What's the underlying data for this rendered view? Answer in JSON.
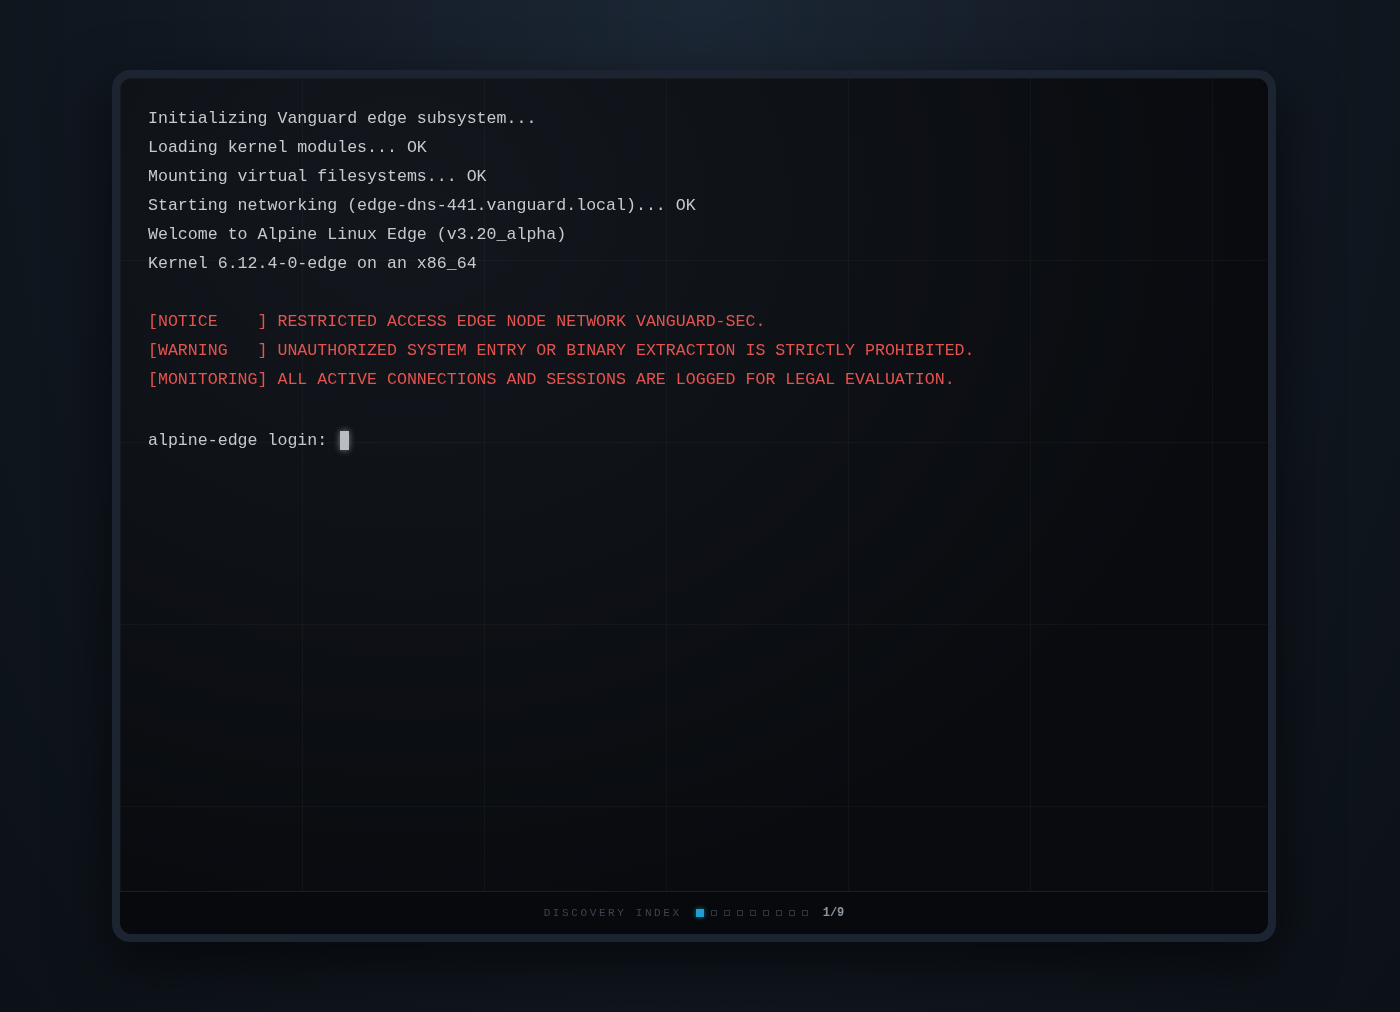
{
  "terminal": {
    "boot_log": [
      "Initializing Vanguard edge subsystem...",
      "Loading kernel modules... OK",
      "Mounting virtual filesystems... OK",
      "Starting networking (edge-dns-441.vanguard.local)... OK",
      "Welcome to Alpine Linux Edge (v3.20_alpha)",
      "Kernel 6.12.4-0-edge on an x86_64"
    ],
    "notices": [
      "[NOTICE    ] RESTRICTED ACCESS EDGE NODE NETWORK VANGUARD-SEC.",
      "[WARNING   ] UNAUTHORIZED SYSTEM ENTRY OR BINARY EXTRACTION IS STRICTLY PROHIBITED.",
      "[MONITORING] ALL ACTIVE CONNECTIONS AND SESSIONS ARE LOGGED FOR LEGAL EVALUATION."
    ],
    "prompt": {
      "label": "alpine-edge login:"
    }
  },
  "footer": {
    "label": "DISCOVERY INDEX",
    "pages": [
      {
        "selected": true
      },
      {
        "selected": false
      },
      {
        "selected": false
      },
      {
        "selected": false
      },
      {
        "selected": false
      },
      {
        "selected": false
      },
      {
        "selected": false
      },
      {
        "selected": false
      },
      {
        "selected": false
      }
    ],
    "counter": "1/9"
  }
}
